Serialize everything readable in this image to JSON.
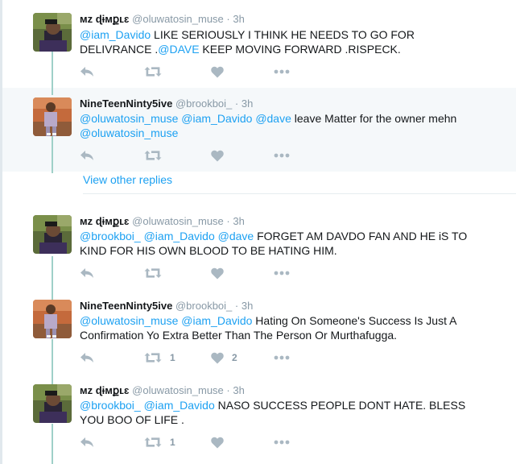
{
  "tweets": [
    {
      "name": "ᴍz ɖɨᴍքʟɛ",
      "handle": "@oluwatosin_muse",
      "time": "3h",
      "segments": [
        {
          "t": "@iam_Davido",
          "m": true
        },
        {
          "t": " LIKE SERIOUSLY I THINK HE NEEDS TO GO FOR DELIVRANCE .",
          "m": false
        },
        {
          "t": "@DAVE",
          "m": true
        },
        {
          "t": " KEEP MOVING FORWARD .RISPECK.",
          "m": false
        }
      ],
      "retweet_count": "",
      "like_count": ""
    },
    {
      "name": "NineTeenNinty5ive",
      "handle": "@brookboi_",
      "time": "3h",
      "segments": [
        {
          "t": "@oluwatosin_muse",
          "m": true
        },
        {
          "t": " ",
          "m": false
        },
        {
          "t": "@iam_Davido",
          "m": true
        },
        {
          "t": " ",
          "m": false
        },
        {
          "t": "@dave",
          "m": true
        },
        {
          "t": " leave Matter for  the  owner mehn ",
          "m": false
        },
        {
          "t": "@oluwatosin_muse",
          "m": true
        }
      ],
      "retweet_count": "",
      "like_count": ""
    },
    {
      "name": "ᴍz ɖɨᴍքʟɛ",
      "handle": "@oluwatosin_muse",
      "time": "3h",
      "segments": [
        {
          "t": "@brookboi_",
          "m": true
        },
        {
          "t": " ",
          "m": false
        },
        {
          "t": "@iam_Davido",
          "m": true
        },
        {
          "t": " ",
          "m": false
        },
        {
          "t": "@dave",
          "m": true
        },
        {
          "t": "  FORGET AM DAVDO FAN AND HE iS  TO KIND FOR HIS OWN BLOOD TO BE HATING HIM.",
          "m": false
        }
      ],
      "retweet_count": "",
      "like_count": ""
    },
    {
      "name": "NineTeenNinty5ive",
      "handle": "@brookboi_",
      "time": "3h",
      "segments": [
        {
          "t": "@oluwatosin_muse",
          "m": true
        },
        {
          "t": " ",
          "m": false
        },
        {
          "t": "@iam_Davido",
          "m": true
        },
        {
          "t": " Hating On Someone's Success Is Just A Confirmation Yo Extra Better Than The Person Or Murthafugga.",
          "m": false
        }
      ],
      "retweet_count": "1",
      "like_count": "2"
    },
    {
      "name": "ᴍz ɖɨᴍքʟɛ",
      "handle": "@oluwatosin_muse",
      "time": "3h",
      "segments": [
        {
          "t": "@brookboi_",
          "m": true
        },
        {
          "t": " ",
          "m": false
        },
        {
          "t": "@iam_Davido",
          "m": true
        },
        {
          "t": "  NASO SUCCESS PEOPLE DONT HATE. BLESS YOU BOO OF LIFE .",
          "m": false
        }
      ],
      "retweet_count": "1",
      "like_count": ""
    }
  ],
  "view_other_replies": "View other replies",
  "colors": {
    "mention": "#1da1f2",
    "thread_line": "#9fd0c8",
    "action_icon": "#aab8c2",
    "meta_text": "#8899a6",
    "highlight_bg": "#f5f8fa"
  },
  "icons": {
    "reply": "reply-icon",
    "retweet": "retweet-icon",
    "like": "heart-icon",
    "more": "more-icon"
  }
}
